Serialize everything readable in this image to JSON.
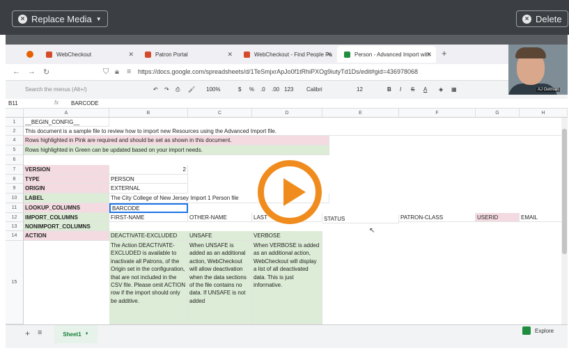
{
  "player": {
    "replace_label": "Replace Media",
    "delete_label": "Delete"
  },
  "browser": {
    "tabs": [
      {
        "label": "WebCheckout",
        "color": "#d54a2b"
      },
      {
        "label": "Patron Portal",
        "color": "#d54a2b"
      },
      {
        "label": "WebCheckout - Find People Pa",
        "color": "#d54a2b"
      },
      {
        "label": "Person - Advanced Import with",
        "color": "#1e8e3e"
      }
    ],
    "url": "https://docs.google.com/spreadsheets/d/1TeSmjxrApJo0f1tRhiPXOg9iutyTd1Ds/edit#gid=436978068"
  },
  "toolbar": {
    "menu_search": "Search the menus (Alt+/)",
    "zoom": "100%",
    "currency": "$",
    "percent": "%",
    "dec_less": ".0",
    "dec_more": ".00",
    "format": "123",
    "font": "Calibri",
    "font_size": "12",
    "bold": "B",
    "italic": "I",
    "strike": "S",
    "text_color": "A"
  },
  "webcam": {
    "name": "AJ Oetman"
  },
  "formula_bar": {
    "cell_ref": "B11",
    "fx": "fx",
    "value": "BARCODE"
  },
  "columns": [
    "A",
    "B",
    "C",
    "D",
    "E",
    "F",
    "G",
    "H"
  ],
  "rows": [
    "1",
    "2",
    "4",
    "5",
    "6",
    "7",
    "8",
    "9",
    "10",
    "11",
    "12",
    "13",
    "14",
    "15"
  ],
  "cells": {
    "r1a": "__BEGIN_CONFIG__",
    "r2a": "This document is a sample file to review how to import new Resources using the Advanced Import file.",
    "r4a": "Rows highlighted in Pink are required and should be set as shown in this document.",
    "r5a": "Rows highlighted in Green can be updated based on your import needs.",
    "r7a": "VERSION",
    "r7b": "2",
    "r8a": "TYPE",
    "r8b": "PERSON",
    "r9a": "ORIGIN",
    "r9b": "EXTERNAL",
    "r10a": "LABEL",
    "r10b": "The City College of New Jersey Import 1 Person file",
    "r11a": "LOOKUP_COLUMNS",
    "r11b": "BARCODE",
    "r12a": "IMPORT_COLUMNS",
    "r12b": "FIRST-NAME",
    "r12c": "OTHER-NAME",
    "r12d": "LAST",
    "r12e": "STATUS",
    "r12f": "PATRON-CLASS",
    "r12g": "USERID",
    "r12h": "EMAIL",
    "r13a": "NONIMPORT_COLUMNS",
    "r14a": "ACTION",
    "r14b": "DEACTIVATE-EXCLUDED",
    "r14c": "UNSAFE",
    "r14d": "VERBOSE",
    "r15b": "The Action DEACTIVATE-EXCLUDED is available to inactivate all Patrons, of the Origin set in the configuration, that are not included in the CSV file. Please omit ACTION row if the import should only be additive.",
    "r15c": "When UNSAFE is added as an additional action, WebCheckout will allow deactivation when the data sections of the file contains no data. If UNSAFE is not added",
    "r15d": "When VERBOSE is added as an additional action, WebCheckout will display a list of all deactivated data. This is just informative."
  },
  "sheet_tab": "Sheet1",
  "explore_label": "Explore"
}
